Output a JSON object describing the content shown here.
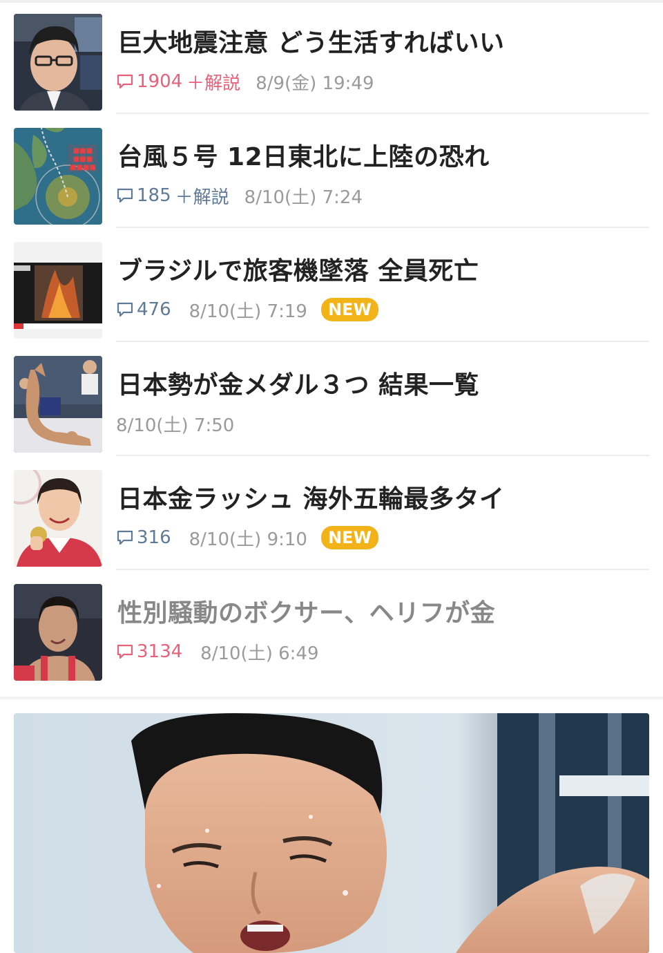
{
  "news": [
    {
      "title": "巨大地震注意 どう生活すればいい",
      "count": "1904",
      "extra": "＋解説",
      "date": "8/9(金) 19:49",
      "badge": "",
      "count_style": "hot",
      "visited": false,
      "thumb": "news-anchor"
    },
    {
      "title": "台風５号 12日東北に上陸の恐れ",
      "count": "185",
      "extra": "＋解説",
      "date": "8/10(土) 7:24",
      "badge": "",
      "count_style": "normal",
      "visited": false,
      "thumb": "typhoon-map"
    },
    {
      "title": "ブラジルで旅客機墜落 全員死亡",
      "count": "476",
      "extra": "",
      "date": "8/10(土) 7:19",
      "badge": "NEW",
      "count_style": "normal",
      "visited": false,
      "thumb": "crash-footage"
    },
    {
      "title": "日本勢が金メダル３つ 結果一覧",
      "count": "",
      "extra": "",
      "date": "8/10(土) 7:50",
      "badge": "",
      "count_style": "normal",
      "visited": false,
      "thumb": "wrestling"
    },
    {
      "title": "日本金ラッシュ 海外五輪最多タイ",
      "count": "316",
      "extra": "",
      "date": "8/10(土) 9:10",
      "badge": "NEW",
      "count_style": "normal",
      "visited": false,
      "thumb": "medalist"
    },
    {
      "title": "性別騒動のボクサー、ヘリフが金",
      "count": "3134",
      "extra": "",
      "date": "8/10(土) 6:49",
      "badge": "",
      "count_style": "hot",
      "visited": true,
      "thumb": "boxer"
    }
  ],
  "colors": {
    "hot": "#e8607a",
    "normal": "#5f7a96",
    "badge": "#f2b319",
    "accent_text": "#222222"
  },
  "hero": {
    "thumb": "swimmer-photo"
  }
}
